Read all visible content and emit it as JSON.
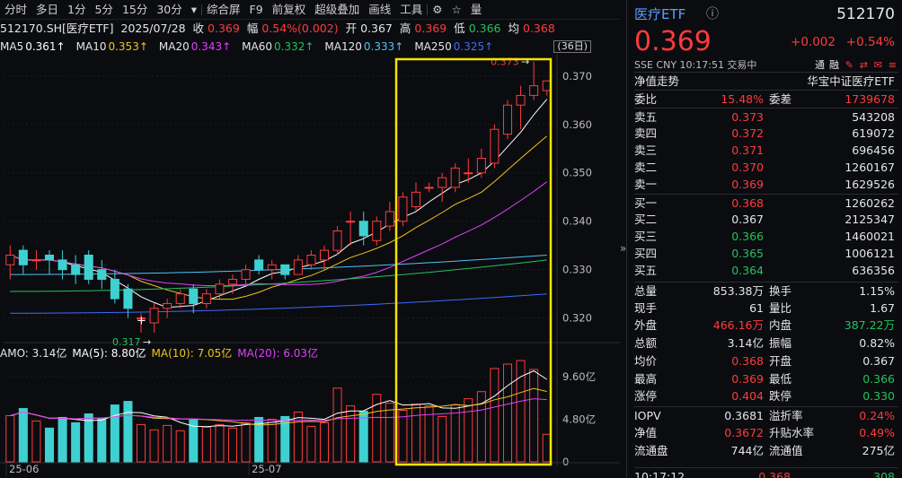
{
  "toolbar": {
    "items": [
      "分时",
      "多日",
      "1分",
      "5分",
      "15分",
      "30分",
      "▾",
      "综合屏",
      "F9",
      "前复权",
      "超级叠加",
      "画线",
      "工具",
      "⚙",
      "☆",
      "量"
    ]
  },
  "symbol_line": {
    "code": "512170.SH[医疗ETF]",
    "date": "2025/07/28",
    "close_label": "收",
    "close": "0.369",
    "change_label": "幅",
    "change": "0.54%(0.002)",
    "open_label": "开",
    "open": "0.367",
    "high_label": "高",
    "high": "0.369",
    "low_label": "低",
    "low": "0.366",
    "avg_label": "均",
    "avg": "0.368"
  },
  "ma_line": [
    {
      "label": "MA5",
      "value": "0.361↑",
      "color": "#ffffff"
    },
    {
      "label": "MA10",
      "value": "0.353↑",
      "color": "#f0c419"
    },
    {
      "label": "MA20",
      "value": "0.343↑",
      "color": "#e040fb"
    },
    {
      "label": "MA60",
      "value": "0.332↑",
      "color": "#22c35a"
    },
    {
      "label": "MA120",
      "value": "0.333↑",
      "color": "#4fc3f7"
    },
    {
      "label": "MA250",
      "value": "0.325↑",
      "color": "#3d6bff"
    }
  ],
  "days_badge": "(36日)",
  "amo_line": [
    {
      "label": "AMO: 3.14亿",
      "color": "#e6e6e6"
    },
    {
      "label": "MA(5): 8.80亿",
      "color": "#ffffff"
    },
    {
      "label": "MA(10): 7.05亿",
      "color": "#f0c419"
    },
    {
      "label": "MA(20): 6.03亿",
      "color": "#e040fb"
    }
  ],
  "chart_data": {
    "type": "candlestick",
    "price_axis": [
      "0.370",
      "0.360",
      "0.350",
      "0.340",
      "0.330",
      "0.320"
    ],
    "price_range": [
      0.3153,
      0.3746
    ],
    "volume_axis": [
      "9.60亿",
      "4.80亿",
      "0"
    ],
    "volume_range": [
      0,
      11.2
    ],
    "x_labels": [
      "25-06",
      "25-07"
    ],
    "high_marker": "0.373",
    "low_marker": "0.317",
    "candles": [
      {
        "o": 0.331,
        "h": 0.335,
        "l": 0.328,
        "c": 0.333,
        "v": 5.2
      },
      {
        "o": 0.334,
        "h": 0.335,
        "l": 0.329,
        "c": 0.331,
        "v": 6.0
      },
      {
        "o": 0.332,
        "h": 0.334,
        "l": 0.33,
        "c": 0.332,
        "v": 4.6
      },
      {
        "o": 0.333,
        "h": 0.334,
        "l": 0.329,
        "c": 0.332,
        "v": 3.8
      },
      {
        "o": 0.332,
        "h": 0.334,
        "l": 0.328,
        "c": 0.33,
        "v": 5.0
      },
      {
        "o": 0.331,
        "h": 0.333,
        "l": 0.327,
        "c": 0.329,
        "v": 4.4
      },
      {
        "o": 0.333,
        "h": 0.334,
        "l": 0.327,
        "c": 0.328,
        "v": 5.4
      },
      {
        "o": 0.33,
        "h": 0.332,
        "l": 0.326,
        "c": 0.328,
        "v": 4.9
      },
      {
        "o": 0.328,
        "h": 0.33,
        "l": 0.323,
        "c": 0.324,
        "v": 6.4
      },
      {
        "o": 0.326,
        "h": 0.327,
        "l": 0.32,
        "c": 0.322,
        "v": 6.8
      },
      {
        "o": 0.32,
        "h": 0.321,
        "l": 0.317,
        "c": 0.32,
        "v": 4.2
      },
      {
        "o": 0.319,
        "h": 0.323,
        "l": 0.317,
        "c": 0.322,
        "v": 3.6
      },
      {
        "o": 0.322,
        "h": 0.324,
        "l": 0.32,
        "c": 0.323,
        "v": 4.1
      },
      {
        "o": 0.323,
        "h": 0.326,
        "l": 0.322,
        "c": 0.325,
        "v": 3.5
      },
      {
        "o": 0.326,
        "h": 0.327,
        "l": 0.321,
        "c": 0.323,
        "v": 4.7
      },
      {
        "o": 0.323,
        "h": 0.326,
        "l": 0.322,
        "c": 0.325,
        "v": 3.9
      },
      {
        "o": 0.325,
        "h": 0.328,
        "l": 0.324,
        "c": 0.327,
        "v": 4.2
      },
      {
        "o": 0.327,
        "h": 0.329,
        "l": 0.325,
        "c": 0.328,
        "v": 3.8
      },
      {
        "o": 0.328,
        "h": 0.331,
        "l": 0.327,
        "c": 0.33,
        "v": 4.4
      },
      {
        "o": 0.332,
        "h": 0.333,
        "l": 0.329,
        "c": 0.33,
        "v": 5.0
      },
      {
        "o": 0.33,
        "h": 0.332,
        "l": 0.328,
        "c": 0.331,
        "v": 4.8
      },
      {
        "o": 0.331,
        "h": 0.331,
        "l": 0.328,
        "c": 0.329,
        "v": 5.1
      },
      {
        "o": 0.329,
        "h": 0.333,
        "l": 0.329,
        "c": 0.332,
        "v": 5.6
      },
      {
        "o": 0.331,
        "h": 0.334,
        "l": 0.33,
        "c": 0.333,
        "v": 4.0
      },
      {
        "o": 0.332,
        "h": 0.335,
        "l": 0.33,
        "c": 0.334,
        "v": 4.4
      },
      {
        "o": 0.334,
        "h": 0.339,
        "l": 0.333,
        "c": 0.338,
        "v": 8.3
      },
      {
        "o": 0.34,
        "h": 0.342,
        "l": 0.335,
        "c": 0.34,
        "v": 6.3
      },
      {
        "o": 0.34,
        "h": 0.342,
        "l": 0.335,
        "c": 0.337,
        "v": 5.7
      },
      {
        "o": 0.336,
        "h": 0.341,
        "l": 0.335,
        "c": 0.34,
        "v": 7.6
      },
      {
        "o": 0.339,
        "h": 0.344,
        "l": 0.338,
        "c": 0.342,
        "v": 6.6
      },
      {
        "o": 0.34,
        "h": 0.346,
        "l": 0.339,
        "c": 0.345,
        "v": 5.8
      },
      {
        "o": 0.343,
        "h": 0.348,
        "l": 0.342,
        "c": 0.346,
        "v": 6.5
      },
      {
        "o": 0.347,
        "h": 0.348,
        "l": 0.346,
        "c": 0.347,
        "v": 6.3
      },
      {
        "o": 0.347,
        "h": 0.35,
        "l": 0.344,
        "c": 0.349,
        "v": 5.1
      },
      {
        "o": 0.347,
        "h": 0.352,
        "l": 0.346,
        "c": 0.351,
        "v": 6.4
      },
      {
        "o": 0.35,
        "h": 0.353,
        "l": 0.348,
        "c": 0.35,
        "v": 7.1
      },
      {
        "o": 0.35,
        "h": 0.355,
        "l": 0.349,
        "c": 0.353,
        "v": 7.9
      },
      {
        "o": 0.352,
        "h": 0.36,
        "l": 0.351,
        "c": 0.359,
        "v": 10.5
      },
      {
        "o": 0.358,
        "h": 0.365,
        "l": 0.357,
        "c": 0.364,
        "v": 11.0
      },
      {
        "o": 0.364,
        "h": 0.368,
        "l": 0.359,
        "c": 0.366,
        "v": 11.4
      },
      {
        "o": 0.366,
        "h": 0.373,
        "l": 0.365,
        "c": 0.368,
        "v": 10.4
      },
      {
        "o": 0.367,
        "h": 0.369,
        "l": 0.366,
        "c": 0.369,
        "v": 3.1
      }
    ]
  },
  "quote": {
    "name": "医疗ETF",
    "code": "512170",
    "price": "0.369",
    "change": "+0.002",
    "change_pct": "+0.54%",
    "meta": "SSE  CNY  10:17:51  交易中",
    "right_icons": [
      "通",
      "融",
      "✎",
      "⇄",
      "✉",
      "≡"
    ],
    "nav_label": "净值走势",
    "index_label": "华宝中证医疗ETF",
    "wb_label": "委比",
    "wb_value": "15.48%",
    "wc_label": "委差",
    "wc_value": "1739678",
    "asks": [
      {
        "label": "卖五",
        "price": "0.373",
        "qty": "543208"
      },
      {
        "label": "卖四",
        "price": "0.372",
        "qty": "619072"
      },
      {
        "label": "卖三",
        "price": "0.371",
        "qty": "696456"
      },
      {
        "label": "卖二",
        "price": "0.370",
        "qty": "1260167"
      },
      {
        "label": "卖一",
        "price": "0.369",
        "qty": "1629526"
      }
    ],
    "bids": [
      {
        "label": "买一",
        "price": "0.368",
        "qty": "1260262",
        "color": "#ff3b3b"
      },
      {
        "label": "买二",
        "price": "0.367",
        "qty": "2125347",
        "color": "#e6e6e6"
      },
      {
        "label": "买三",
        "price": "0.366",
        "qty": "1460021",
        "color": "#22c35a"
      },
      {
        "label": "买四",
        "price": "0.365",
        "qty": "1006121",
        "color": "#22c35a"
      },
      {
        "label": "买五",
        "price": "0.364",
        "qty": "636356",
        "color": "#22c35a"
      }
    ],
    "stats": [
      {
        "l1": "总量",
        "v1": "853.38万",
        "c1": "#e6e6e6",
        "l2": "换手",
        "v2": "1.15%",
        "c2": "#e6e6e6"
      },
      {
        "l1": "现手",
        "v1": "61",
        "c1": "#e6e6e6",
        "l2": "量比",
        "v2": "1.67",
        "c2": "#e6e6e6"
      },
      {
        "l1": "外盘",
        "v1": "466.16万",
        "c1": "#ff3b3b",
        "l2": "内盘",
        "v2": "387.22万",
        "c2": "#22c35a"
      },
      {
        "l1": "总额",
        "v1": "3.14亿",
        "c1": "#e6e6e6",
        "l2": "振幅",
        "v2": "0.82%",
        "c2": "#e6e6e6"
      },
      {
        "l1": "均价",
        "v1": "0.368",
        "c1": "#ff3b3b",
        "l2": "开盘",
        "v2": "0.367",
        "c2": "#e6e6e6"
      },
      {
        "l1": "最高",
        "v1": "0.369",
        "c1": "#ff3b3b",
        "l2": "最低",
        "v2": "0.366",
        "c2": "#22c35a"
      },
      {
        "l1": "涨停",
        "v1": "0.404",
        "c1": "#ff3b3b",
        "l2": "跌停",
        "v2": "0.330",
        "c2": "#22c35a"
      }
    ],
    "stats2": [
      {
        "l1": "IOPV",
        "v1": "0.3681",
        "c1": "#e6e6e6",
        "l2": "溢折率",
        "v2": "0.24%",
        "c2": "#ff3b3b"
      },
      {
        "l1": "净值",
        "v1": "0.3672",
        "c1": "#ff3b3b",
        "l2": "升贴水率",
        "v2": "0.49%",
        "c2": "#ff3b3b"
      },
      {
        "l1": "流通盘",
        "v1": "744亿",
        "c1": "#e6e6e6",
        "l2": "流通值",
        "v2": "275亿",
        "c2": "#e6e6e6"
      }
    ],
    "last_trade": {
      "time": "10:17:12",
      "price": "0.368",
      "qty": "308"
    }
  },
  "colors": {
    "up": "#ff3b3b",
    "down": "#3fd1d1",
    "highlight_box": "#f5e400"
  }
}
